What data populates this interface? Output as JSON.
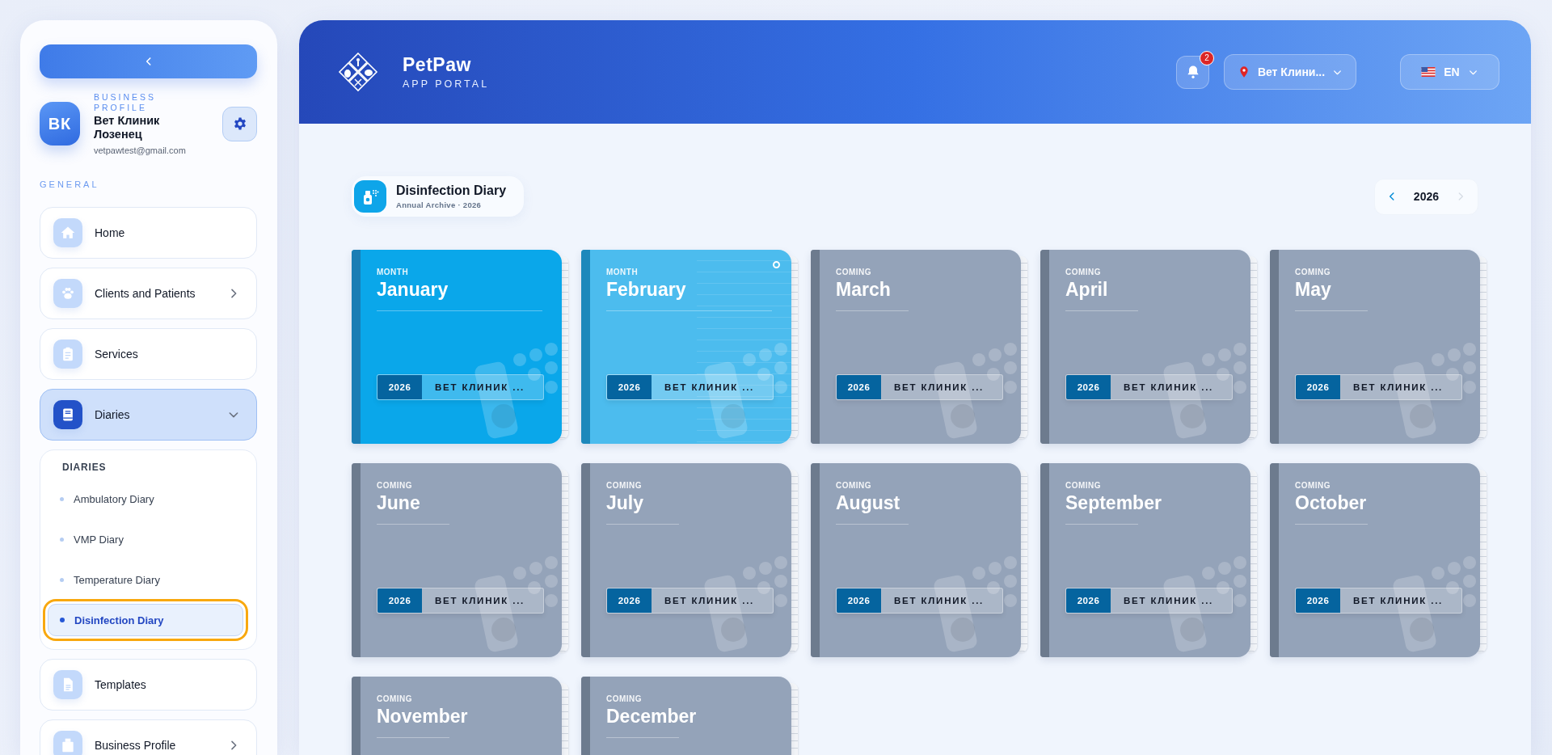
{
  "sidebar": {
    "profile": {
      "label": "BUSINESS PROFILE",
      "initials": "ВК",
      "name": "Вет Клиник Лозенец",
      "email": "vetpawtest@gmail.com"
    },
    "section_label": "GENERAL",
    "nav_items": [
      {
        "label": "Home",
        "selected": false
      },
      {
        "label": "Clients and Patients",
        "expanded": false,
        "selected": false
      },
      {
        "label": "Services",
        "selected": false
      },
      {
        "label": "Diaries",
        "expanded": true,
        "selected": true,
        "submenu": {
          "title": "DIARIES",
          "items": [
            {
              "label": "Ambulatory Diary",
              "selected": false
            },
            {
              "label": "VMP Diary",
              "selected": false
            },
            {
              "label": "Temperature Diary",
              "selected": false
            },
            {
              "label": "Disinfection Diary",
              "selected": true
            }
          ]
        }
      },
      {
        "label": "Templates",
        "selected": false
      },
      {
        "label": "Business Profile",
        "expanded": false,
        "selected": false
      }
    ]
  },
  "header": {
    "brand": "PetPaw",
    "tagline": "APP PORTAL",
    "notifications": {
      "count": "2"
    },
    "location": "Вет Клини...",
    "language": "EN"
  },
  "page": {
    "title": "Disinfection Diary",
    "subtitle": "Annual Archive · 2026",
    "year_picker": {
      "year": "2026",
      "prev_disabled": false,
      "next_disabled": true
    },
    "months": [
      {
        "label": "MONTH",
        "name": "January",
        "kind": "open",
        "hovered": false,
        "year": "2026",
        "clinic": "ВЕТ КЛИНИК ..."
      },
      {
        "label": "MONTH",
        "name": "February",
        "kind": "open",
        "hovered": true,
        "year": "2026",
        "clinic": "ВЕТ КЛИНИК ..."
      },
      {
        "label": "COMING",
        "name": "March",
        "kind": "coming",
        "hovered": false,
        "year": "2026",
        "clinic": "ВЕТ КЛИНИК ..."
      },
      {
        "label": "COMING",
        "name": "April",
        "kind": "coming",
        "hovered": false,
        "year": "2026",
        "clinic": "ВЕТ КЛИНИК ..."
      },
      {
        "label": "COMING",
        "name": "May",
        "kind": "coming",
        "hovered": false,
        "year": "2026",
        "clinic": "ВЕТ КЛИНИК ..."
      },
      {
        "label": "COMING",
        "name": "June",
        "kind": "coming",
        "hovered": false,
        "year": "2026",
        "clinic": "ВЕТ КЛИНИК ..."
      },
      {
        "label": "COMING",
        "name": "July",
        "kind": "coming",
        "hovered": false,
        "year": "2026",
        "clinic": "ВЕТ КЛИНИК ..."
      },
      {
        "label": "COMING",
        "name": "August",
        "kind": "coming",
        "hovered": false,
        "year": "2026",
        "clinic": "ВЕТ КЛИНИК ..."
      },
      {
        "label": "COMING",
        "name": "September",
        "kind": "coming",
        "hovered": false,
        "year": "2026",
        "clinic": "ВЕТ КЛИНИК ..."
      },
      {
        "label": "COMING",
        "name": "October",
        "kind": "coming",
        "hovered": false,
        "year": "2026",
        "clinic": "ВЕТ КЛИНИК ..."
      },
      {
        "label": "COMING",
        "name": "November",
        "kind": "coming",
        "hovered": false
      },
      {
        "label": "COMING",
        "name": "December",
        "kind": "coming",
        "hovered": false
      }
    ]
  }
}
